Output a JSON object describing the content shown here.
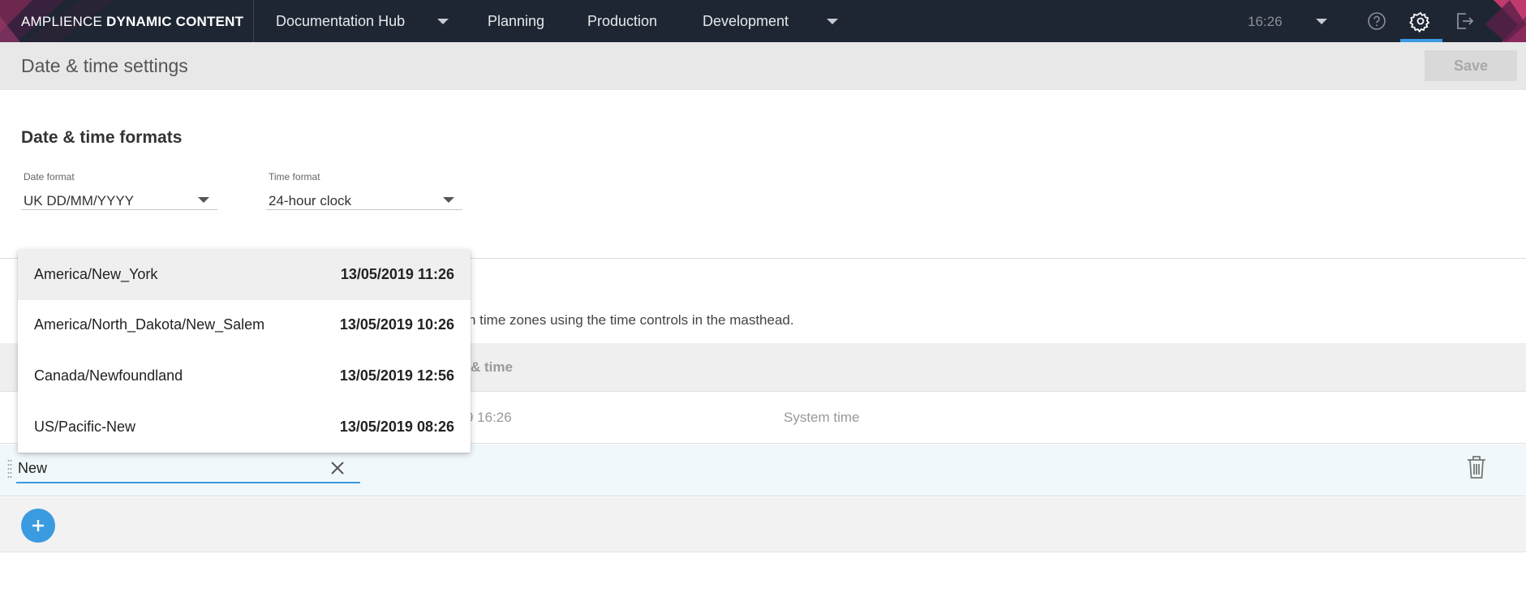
{
  "masthead": {
    "brand_light": "AMPLIENCE ",
    "brand_bold": "DYNAMIC CONTENT",
    "hub": "Documentation Hub",
    "nav": [
      "Planning",
      "Production",
      "Development"
    ],
    "clock": "16:26",
    "icons": [
      "chevron-down-icon",
      "help-icon",
      "gear-icon",
      "logout-icon"
    ],
    "accent": "#3b9be0",
    "background": "#1f2633"
  },
  "page": {
    "title": "Date & time settings",
    "save_label": "Save"
  },
  "formats": {
    "title": "Date & time formats",
    "date_label": "Date format",
    "date_value": "UK DD/MM/YYYY",
    "time_label": "Time format",
    "time_value": "24-hour clock"
  },
  "timezones": {
    "description_visible": "n time zones using the time controls in the masthead.",
    "header_datetime_visible": "& time",
    "system_row": {
      "time_visible": "9 16:26",
      "type": "System time"
    },
    "edit_row": {
      "input_value": "New"
    }
  },
  "dropdown": {
    "items": [
      {
        "name": "America/New_York",
        "time": "13/05/2019 11:26"
      },
      {
        "name": "America/North_Dakota/New_Salem",
        "time": "13/05/2019 10:26"
      },
      {
        "name": "Canada/Newfoundland",
        "time": "13/05/2019 12:56"
      },
      {
        "name": "US/Pacific-New",
        "time": "13/05/2019 08:26"
      }
    ]
  }
}
